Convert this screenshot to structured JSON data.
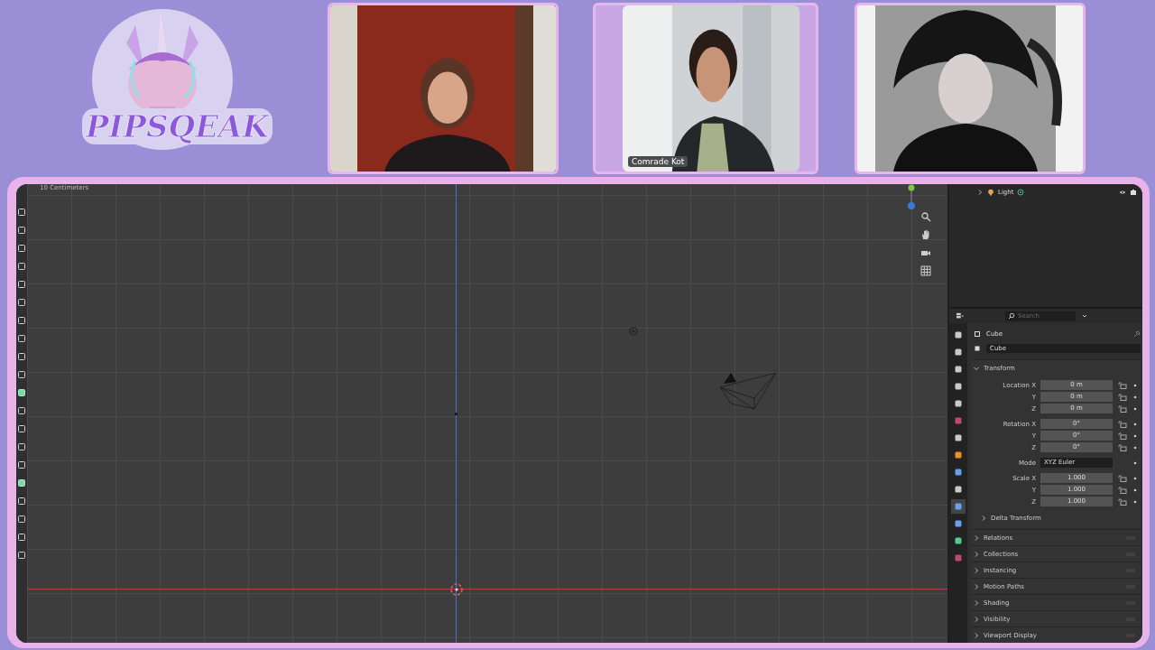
{
  "logo": {
    "text": "PIPSQEAK"
  },
  "webcams": [
    {
      "kind": "picture"
    },
    {
      "kind": "picture",
      "name": "Comrade Kot"
    },
    {
      "kind": "picture"
    }
  ],
  "viewport": {
    "scale_label": "10 Centimeters"
  },
  "outliner": {
    "rows": [
      {
        "label": "Light",
        "expanded": false
      }
    ]
  },
  "properties": {
    "search": {
      "placeholder": "Search"
    },
    "object": "Cube",
    "datablock": "Cube",
    "transform": {
      "title": "Transform",
      "expanded": true,
      "rows": [
        {
          "label": "Location X",
          "value": "0 m",
          "kind": "number"
        },
        {
          "label": "Y",
          "value": "0 m",
          "kind": "number"
        },
        {
          "label": "Z",
          "value": "0 m",
          "kind": "number"
        },
        {
          "label": "Rotation X",
          "value": "0°",
          "kind": "number"
        },
        {
          "label": "Y",
          "value": "0°",
          "kind": "number"
        },
        {
          "label": "Z",
          "value": "0°",
          "kind": "number"
        },
        {
          "label": "Mode",
          "value": "XYZ Euler",
          "kind": "dropdown"
        },
        {
          "label": "Scale X",
          "value": "1.000",
          "kind": "number"
        },
        {
          "label": "Y",
          "value": "1.000",
          "kind": "number"
        },
        {
          "label": "Z",
          "value": "1.000",
          "kind": "number"
        }
      ],
      "subpanel": {
        "title": "Delta Transform",
        "expanded": false
      }
    },
    "sections": [
      {
        "title": "Relations",
        "expanded": false
      },
      {
        "title": "Collections",
        "expanded": false
      },
      {
        "title": "Instancing",
        "expanded": false
      },
      {
        "title": "Motion Paths",
        "expanded": false
      },
      {
        "title": "Shading",
        "expanded": false
      },
      {
        "title": "Visibility",
        "expanded": false
      },
      {
        "title": "Viewport Display",
        "expanded": false
      }
    ]
  }
}
